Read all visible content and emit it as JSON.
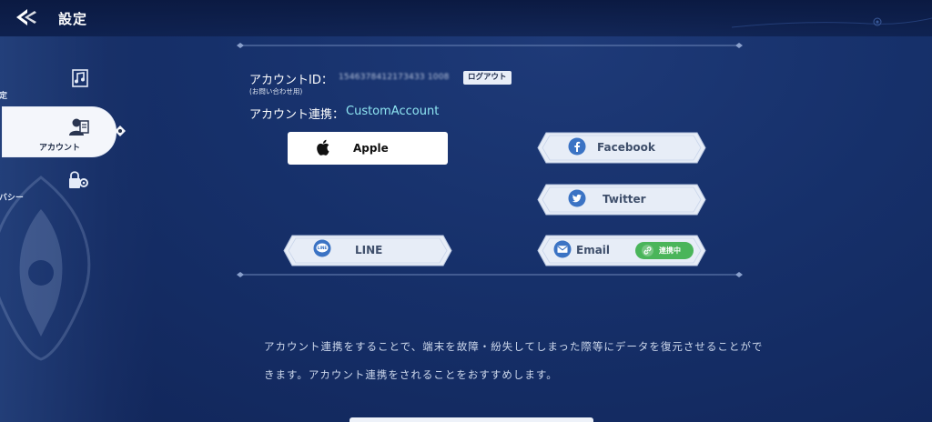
{
  "header": {
    "title": "設定"
  },
  "sidebar": {
    "items": [
      {
        "label": "設定",
        "icon": "music-note-icon"
      },
      {
        "label": "アカウント",
        "icon": "account-card-icon",
        "active": true
      },
      {
        "label": "プライバシー",
        "icon": "lock-gear-icon"
      }
    ]
  },
  "account": {
    "id_label": "アカウントID：",
    "id_value": "1546378412173433 1008",
    "logout_label": "ログアウト",
    "inquiry_note": "(お問い合わせ用)",
    "link_label": "アカウント連携：",
    "link_value": "CustomAccount"
  },
  "providers": {
    "apple": "Apple",
    "facebook": "Facebook",
    "twitter": "Twitter",
    "line": "LINE",
    "line_icon_text": "LINE",
    "email": "Email",
    "email_status": "連携中"
  },
  "description": "アカウント連携をすることで、端末を故障・紛失してしまった際等にデータを復元させることができます。アカウント連携をされることをおすすめします。",
  "colors": {
    "accent_cyan": "#8fe6f2",
    "linked_green": "#4ab55a",
    "facebook_blue": "#3b73c4",
    "twitter_blue": "#3b73c4",
    "line_blue": "#3b73c4"
  }
}
